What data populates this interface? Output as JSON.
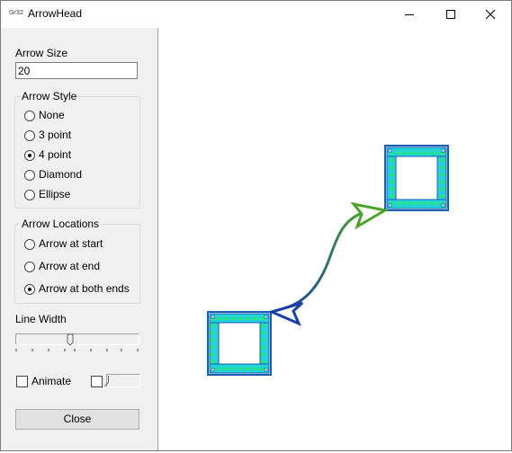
{
  "window": {
    "app_icon_text": "Gr32",
    "title": "ArrowHead"
  },
  "controls": {
    "arrow_size_label": "Arrow Size",
    "arrow_size_value": "20",
    "arrow_style": {
      "title": "Arrow Style",
      "options": [
        "None",
        "3 point",
        "4 point",
        "Diamond",
        "Ellipse"
      ],
      "selected": "4 point"
    },
    "arrow_locations": {
      "title": "Arrow Locations",
      "options": [
        "Arrow at start",
        "Arrow at end",
        "Arrow at both ends"
      ],
      "selected": "Arrow at both ends"
    },
    "line_width_label": "Line Width",
    "animate_label": "Animate",
    "animate_checked": false,
    "close_label": "Close"
  },
  "canvas": {
    "colors": {
      "box_border": "#1a5fb4",
      "box_fill": "#22d3d8",
      "box_fill_alt": "#2ee66e",
      "curve_start": "#4aa42a",
      "curve_end": "#1a3fa8"
    }
  }
}
